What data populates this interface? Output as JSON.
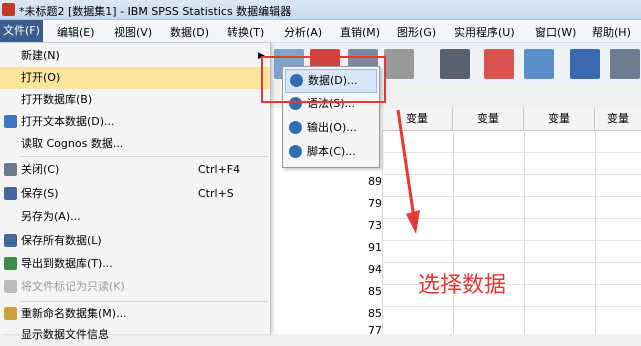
{
  "window": {
    "title": "*未标题2 [数据集1] - IBM SPSS Statistics 数据编辑器"
  },
  "menubar": {
    "items": [
      {
        "label": "文件(F)"
      },
      {
        "label": "编辑(E)"
      },
      {
        "label": "视图(V)"
      },
      {
        "label": "数据(D)"
      },
      {
        "label": "转换(T)"
      },
      {
        "label": "分析(A)"
      },
      {
        "label": "直销(M)"
      },
      {
        "label": "图形(G)"
      },
      {
        "label": "实用程序(U)"
      },
      {
        "label": "窗口(W)"
      },
      {
        "label": "帮助(H)"
      }
    ]
  },
  "file_menu": {
    "items": [
      {
        "label": "新建(N)"
      },
      {
        "label": "打开(O)"
      },
      {
        "label": "打开数据库(B)"
      },
      {
        "label": "打开文本数据(D)..."
      },
      {
        "label": "读取 Cognos 数据..."
      },
      {
        "label": "关闭(C)",
        "shortcut": "Ctrl+F4"
      },
      {
        "label": "保存(S)",
        "shortcut": "Ctrl+S"
      },
      {
        "label": "另存为(A)..."
      },
      {
        "label": "保存所有数据(L)"
      },
      {
        "label": "导出到数据库(T)..."
      },
      {
        "label": "将文件标记为只读(K)"
      },
      {
        "label": "重新命名数据集(M)..."
      },
      {
        "label": "显示数据文件信息"
      }
    ]
  },
  "open_submenu": {
    "items": [
      {
        "label": "数据(D)..."
      },
      {
        "label": "语法(S)..."
      },
      {
        "label": "输出(O)..."
      },
      {
        "label": "脚本(C)..."
      }
    ]
  },
  "grid": {
    "column_header": "变量",
    "values": [
      "89",
      "79",
      "73",
      "91",
      "94",
      "85",
      "85",
      "77"
    ]
  },
  "annotation": {
    "text": "选择数据"
  },
  "colors": {
    "highlight": "#fbe59a",
    "annotation_red": "#e53935",
    "menu_active": "#3a5f8f"
  }
}
